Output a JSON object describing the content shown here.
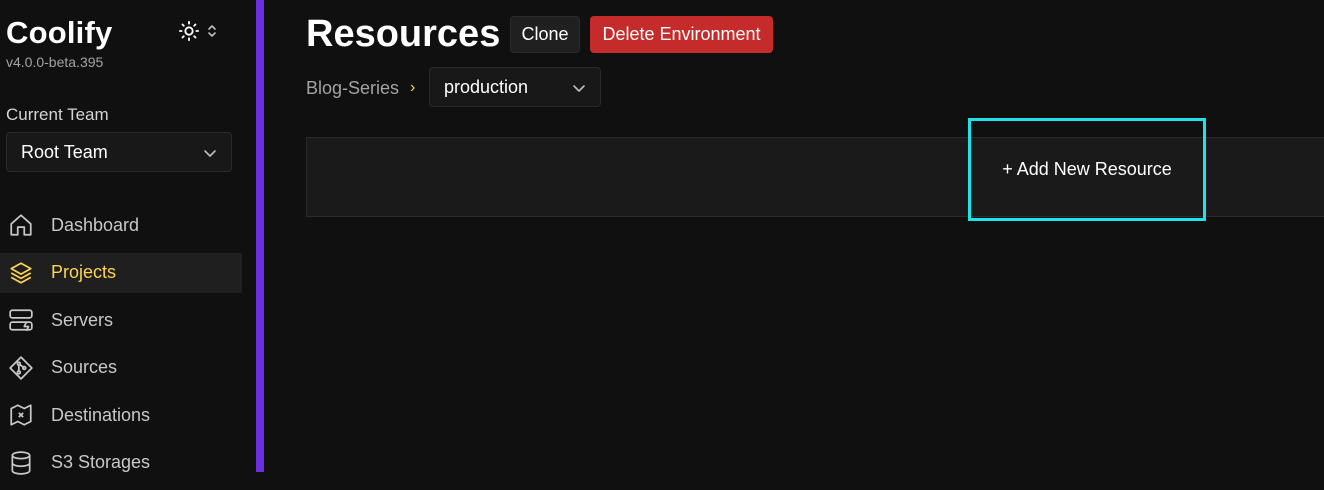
{
  "app": {
    "name": "Coolify",
    "version": "v4.0.0-beta.395"
  },
  "team": {
    "label": "Current Team",
    "selected": "Root Team"
  },
  "nav": {
    "items": [
      {
        "label": "Dashboard",
        "icon": "home-icon"
      },
      {
        "label": "Projects",
        "icon": "layers-icon"
      },
      {
        "label": "Servers",
        "icon": "server-icon"
      },
      {
        "label": "Sources",
        "icon": "git-icon"
      },
      {
        "label": "Destinations",
        "icon": "map-icon"
      },
      {
        "label": "S3 Storages",
        "icon": "database-icon"
      }
    ],
    "active": "Projects"
  },
  "page": {
    "title": "Resources",
    "clone_label": "Clone",
    "delete_label": "Delete Environment",
    "breadcrumb_project": "Blog-Series",
    "breadcrumb_separator": "›",
    "environment": "production",
    "add_resource_label": "+ Add New Resource"
  },
  "colors": {
    "accent": "#fcd452",
    "brand_border": "#6b2fe0",
    "danger": "#c52b2b",
    "highlight": "#1fe3ea"
  }
}
